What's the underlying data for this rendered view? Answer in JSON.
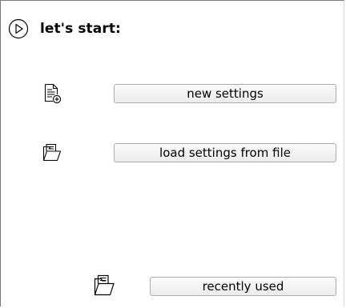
{
  "header": {
    "title": "let's start:",
    "icon": "play-circle-icon"
  },
  "actions": {
    "new_settings": {
      "label": "new settings",
      "icon": "new-document-icon"
    },
    "load_settings": {
      "label": "load settings from file",
      "icon": "open-folder-icon"
    },
    "recently_used": {
      "label": "recently used",
      "icon": "open-folder-icon"
    }
  }
}
